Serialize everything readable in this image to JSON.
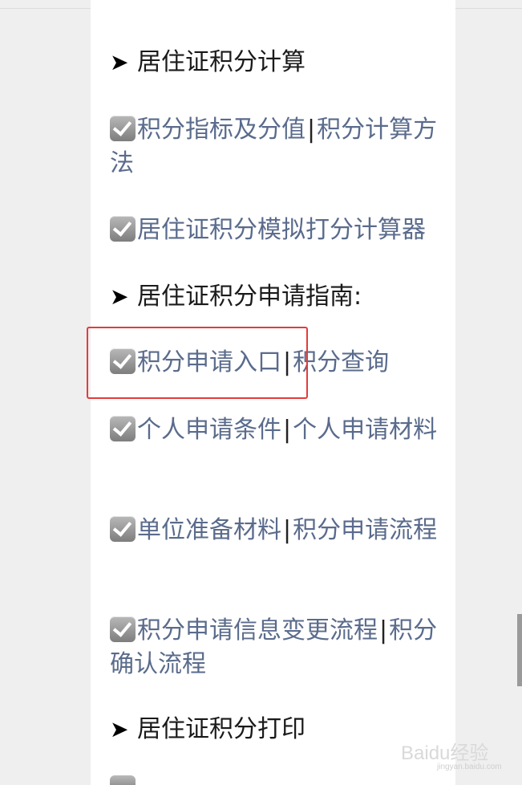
{
  "heading1": "居住证积分计算",
  "item1": {
    "a": "积分指标及分值",
    "sep": "|",
    "b": "积分计算方法"
  },
  "item2": {
    "a": "居住证积分模拟打分计算器"
  },
  "heading2": "居住证积分申请指南:",
  "item3": {
    "a": "积分申请入口",
    "sep": "|",
    "b": "积分查询"
  },
  "item4": {
    "a": "个人申请条件",
    "sep": "|",
    "b": "个人申请材料"
  },
  "item5": {
    "a": "单位准备材料",
    "sep": "|",
    "b": "积分申请流程"
  },
  "item6": {
    "a": "积分申请信息变更流程",
    "sep": "|",
    "b": "积分确认流程"
  },
  "heading3": "居住证积分打印",
  "watermark": {
    "main": "Baidu经验",
    "sub": "jingyan.baidu.com"
  },
  "colors": {
    "link": "#5a6b8c",
    "highlight": "#e53b3b"
  },
  "icons": {
    "arrow": "arrow-right-icon",
    "check": "checkbox-checked-icon"
  }
}
